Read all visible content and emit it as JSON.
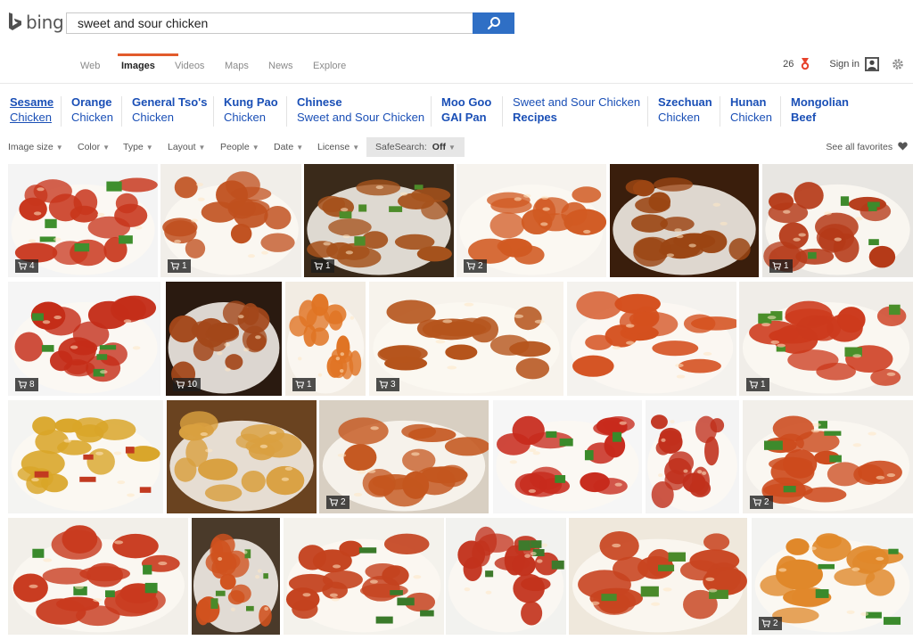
{
  "brand": {
    "name": "bing",
    "accent": "#2f6fc5"
  },
  "search": {
    "query": "sweet and sour chicken"
  },
  "nav": {
    "tabs": [
      {
        "label": "Web"
      },
      {
        "label": "Images"
      },
      {
        "label": "Videos"
      },
      {
        "label": "Maps"
      },
      {
        "label": "News"
      },
      {
        "label": "Explore"
      }
    ],
    "active": "Images"
  },
  "user": {
    "points": "26",
    "signin": "Sign in"
  },
  "related": [
    {
      "line1": "Sesame",
      "line2": "Chicken"
    },
    {
      "line1": "Orange",
      "line2": "Chicken"
    },
    {
      "line1": "General Tso's",
      "line2": "Chicken"
    },
    {
      "line1": "Kung Pao",
      "line2": "Chicken"
    },
    {
      "line1": "Chinese",
      "line2": "Sweet and Sour Chicken"
    },
    {
      "line1": "Moo Goo",
      "line2": "GAI Pan"
    },
    {
      "line1": "Sweet and Sour Chicken",
      "line2": "Recipes"
    },
    {
      "line1": "Szechuan",
      "line2": "Chicken"
    },
    {
      "line1": "Hunan",
      "line2": "Chicken"
    },
    {
      "line1": "Mongolian",
      "line2": "Beef"
    }
  ],
  "filters": {
    "items": [
      "Image size",
      "Color",
      "Type",
      "Layout",
      "People",
      "Date",
      "License"
    ],
    "safesearch_label": "SafeSearch:",
    "safesearch_value": "Off",
    "favorites": "See all favorites"
  },
  "images": [
    {
      "badge": "4",
      "plate": "#f4f4f4",
      "sauce": "#c8361c",
      "veg": "#3f8f2e"
    },
    {
      "badge": "1",
      "plate": "#f1eee9",
      "sauce": "#c0501e",
      "veg": ""
    },
    {
      "badge": "1",
      "plate": "#3a2a1a",
      "sauce": "#a5521c",
      "veg": "#4d8c2a"
    },
    {
      "badge": "2",
      "plate": "#f6f3ee",
      "sauce": "#d15a22",
      "veg": ""
    },
    {
      "badge": "",
      "plate": "#3a1e0c",
      "sauce": "#9b4513",
      "veg": ""
    },
    {
      "badge": "1",
      "plate": "#e8e6e2",
      "sauce": "#b53a18",
      "veg": "#3e8a2c"
    },
    {
      "badge": "8",
      "plate": "#f5f5f5",
      "sauce": "#c42d18",
      "veg": "#3d8b2c"
    },
    {
      "badge": "10",
      "plate": "#2a1a10",
      "sauce": "#a3471a",
      "veg": ""
    },
    {
      "badge": "1",
      "plate": "#f2ece3",
      "sauce": "#e07424",
      "veg": ""
    },
    {
      "badge": "3",
      "plate": "#f7f3ec",
      "sauce": "#b5541c",
      "veg": ""
    },
    {
      "badge": "",
      "plate": "#f4f2ee",
      "sauce": "#d4501e",
      "veg": ""
    },
    {
      "badge": "1",
      "plate": "#f0ede8",
      "sauce": "#cc3a1c",
      "veg": "#4a8f2a"
    },
    {
      "badge": "",
      "plate": "#f4f4f2",
      "sauce": "#d9a528",
      "veg": "#c23a20"
    },
    {
      "badge": "",
      "plate": "#6a4320",
      "sauce": "#d9a040",
      "veg": ""
    },
    {
      "badge": "2",
      "plate": "#d8cfc2",
      "sauce": "#c4561e",
      "veg": ""
    },
    {
      "badge": "",
      "plate": "#f6f6f6",
      "sauce": "#c72a1c",
      "veg": "#3a8a2a"
    },
    {
      "badge": "",
      "plate": "#f4f4f4",
      "sauce": "#c0301c",
      "veg": ""
    },
    {
      "badge": "2",
      "plate": "#f2efea",
      "sauce": "#cc4a1c",
      "veg": "#3e8a2c"
    },
    {
      "badge": "",
      "plate": "#f2efe9",
      "sauce": "#c83a1e",
      "veg": "#3a8a2c"
    },
    {
      "badge": "",
      "plate": "#4a3a2a",
      "sauce": "#d0521e",
      "veg": "#4a8a2a"
    },
    {
      "badge": "",
      "plate": "#f4f2ec",
      "sauce": "#c4421e",
      "veg": "#3a7a2a"
    },
    {
      "badge": "",
      "plate": "#f2f2ef",
      "sauce": "#c2321c",
      "veg": "#3e7a2c"
    },
    {
      "badge": "",
      "plate": "#efe8dc",
      "sauce": "#c84420",
      "veg": "#4a8a2a"
    },
    {
      "badge": "2",
      "plate": "#f3f3f1",
      "sauce": "#e0882a",
      "veg": "#3a8a2c"
    }
  ]
}
